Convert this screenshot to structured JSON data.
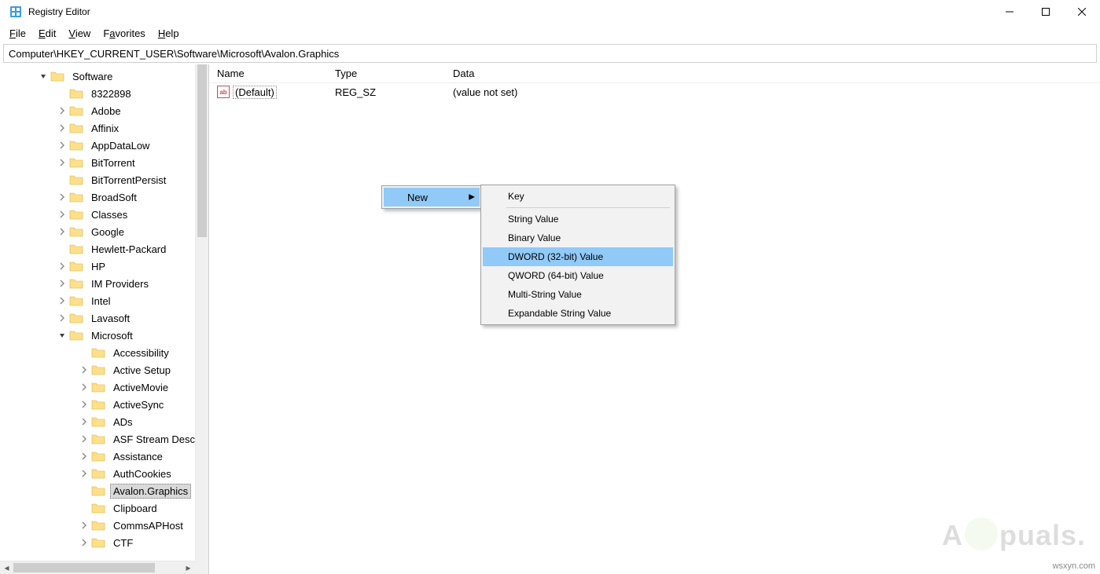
{
  "window": {
    "title": "Registry Editor"
  },
  "menubar": {
    "file": "File",
    "edit": "Edit",
    "view": "View",
    "favorites": "Favorites",
    "help": "Help"
  },
  "address": "Computer\\HKEY_CURRENT_USER\\Software\\Microsoft\\Avalon.Graphics",
  "tree": {
    "root": "Software",
    "software_children": [
      {
        "label": "8322898",
        "exp": ""
      },
      {
        "label": "Adobe",
        "exp": ">"
      },
      {
        "label": "Affinix",
        "exp": ">"
      },
      {
        "label": "AppDataLow",
        "exp": ">"
      },
      {
        "label": "BitTorrent",
        "exp": ">"
      },
      {
        "label": "BitTorrentPersist",
        "exp": ""
      },
      {
        "label": "BroadSoft",
        "exp": ">"
      },
      {
        "label": "Classes",
        "exp": ">"
      },
      {
        "label": "Google",
        "exp": ">"
      },
      {
        "label": "Hewlett-Packard",
        "exp": ""
      },
      {
        "label": "HP",
        "exp": ">"
      },
      {
        "label": "IM Providers",
        "exp": ">"
      },
      {
        "label": "Intel",
        "exp": ">"
      },
      {
        "label": "Lavasoft",
        "exp": ">"
      },
      {
        "label": "Microsoft",
        "exp": "v"
      }
    ],
    "microsoft_children": [
      {
        "label": "Accessibility",
        "exp": ""
      },
      {
        "label": "Active Setup",
        "exp": ">"
      },
      {
        "label": "ActiveMovie",
        "exp": ">"
      },
      {
        "label": "ActiveSync",
        "exp": ">"
      },
      {
        "label": "ADs",
        "exp": ">"
      },
      {
        "label": "ASF Stream Descr",
        "exp": ">"
      },
      {
        "label": "Assistance",
        "exp": ">"
      },
      {
        "label": "AuthCookies",
        "exp": ">"
      },
      {
        "label": "Avalon.Graphics",
        "exp": "",
        "selected": true
      },
      {
        "label": "Clipboard",
        "exp": ""
      },
      {
        "label": "CommsAPHost",
        "exp": ">"
      },
      {
        "label": "CTF",
        "exp": ">"
      }
    ]
  },
  "list": {
    "headers": {
      "name": "Name",
      "type": "Type",
      "data": "Data"
    },
    "rows": [
      {
        "icon": "ab",
        "name": "(Default)",
        "type": "REG_SZ",
        "data": "(value not set)"
      }
    ]
  },
  "contextmenu": {
    "new": "New",
    "submenu": [
      {
        "label": "Key",
        "hl": false,
        "divider_after": true
      },
      {
        "label": "String Value"
      },
      {
        "label": "Binary Value"
      },
      {
        "label": "DWORD (32-bit) Value",
        "hl": true
      },
      {
        "label": "QWORD (64-bit) Value"
      },
      {
        "label": "Multi-String Value"
      },
      {
        "label": "Expandable String Value"
      }
    ]
  },
  "watermark": "A  puals.",
  "credit": "wsxyn.com"
}
